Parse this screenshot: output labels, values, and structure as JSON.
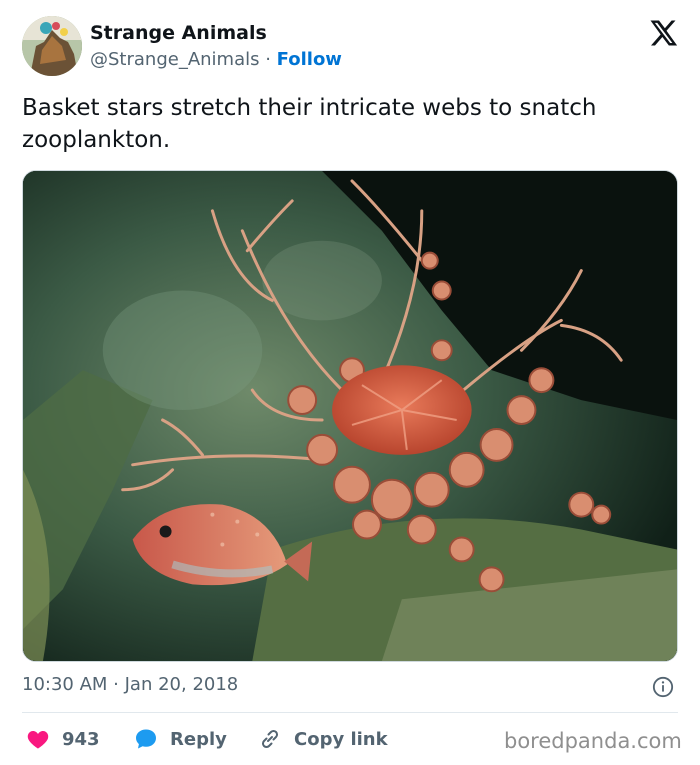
{
  "tweet": {
    "display_name": "Strange Animals",
    "handle": "@Strange_Animals",
    "separator": " · ",
    "follow_label": "Follow",
    "text": "Basket stars stretch their intricate webs to snatch zooplankton.",
    "time": "10:30 AM",
    "date_separator": " · ",
    "date": "Jan 20, 2018"
  },
  "actions": {
    "like_count": "943",
    "reply_label": "Reply",
    "copy_label": "Copy link"
  },
  "icons": {
    "platform": "x-logo-icon",
    "info": "info-icon",
    "like": "heart-icon",
    "reply": "speech-bubble-icon",
    "copy": "link-icon"
  },
  "colors": {
    "accent": "#0074d4",
    "like": "#f91880",
    "reply": "#1d9bf0",
    "muted": "#536471"
  },
  "watermark": "boredpanda.com"
}
